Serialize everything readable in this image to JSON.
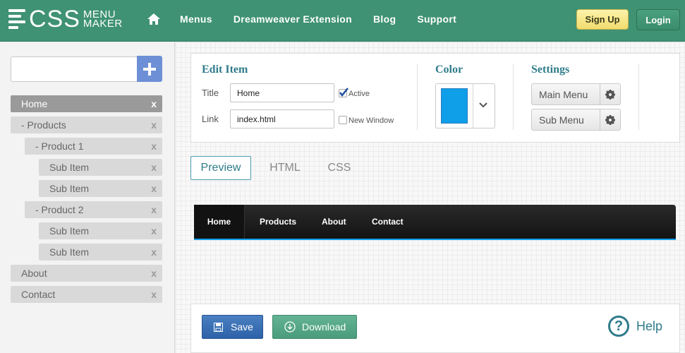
{
  "header": {
    "logo_text": "CSS",
    "logo_line1": "MENU",
    "logo_line2": "MAKER",
    "nav": [
      "Menus",
      "Dreamweaver Extension",
      "Blog",
      "Support"
    ],
    "signup_label": "Sign Up",
    "login_label": "Login"
  },
  "sidebar": {
    "search_value": "",
    "add_label": "+",
    "items": [
      {
        "label": "Home",
        "prefix": "",
        "level": 0,
        "selected": true
      },
      {
        "label": "Products",
        "prefix": "- ",
        "level": 0,
        "selected": false
      },
      {
        "label": "Product 1",
        "prefix": "- ",
        "level": 1,
        "selected": false
      },
      {
        "label": "Sub Item",
        "prefix": "",
        "level": 2,
        "selected": false
      },
      {
        "label": "Sub Item",
        "prefix": "",
        "level": 2,
        "selected": false
      },
      {
        "label": "Product 2",
        "prefix": "- ",
        "level": 1,
        "selected": false
      },
      {
        "label": "Sub Item",
        "prefix": "",
        "level": 2,
        "selected": false
      },
      {
        "label": "Sub Item",
        "prefix": "",
        "level": 2,
        "selected": false
      },
      {
        "label": "About",
        "prefix": "",
        "level": 0,
        "selected": false
      },
      {
        "label": "Contact",
        "prefix": "",
        "level": 0,
        "selected": false
      }
    ],
    "remove_label": "x"
  },
  "edit_item": {
    "heading": "Edit Item",
    "title_label": "Title",
    "title_value": "Home",
    "active_label": "Active",
    "active_checked": true,
    "link_label": "Link",
    "link_value": "index.html",
    "new_window_label": "New Window",
    "new_window_checked": false
  },
  "color": {
    "heading": "Color",
    "value": "#0f9ee8"
  },
  "settings": {
    "heading": "Settings",
    "main_menu_label": "Main Menu",
    "sub_menu_label": "Sub Menu"
  },
  "tabs": [
    "Preview",
    "HTML",
    "CSS"
  ],
  "active_tab": "Preview",
  "preview_menu": {
    "items": [
      "Home",
      "Products",
      "About",
      "Contact"
    ],
    "active": "Home",
    "accent_color": "#0f9ee8"
  },
  "footer": {
    "save_label": "Save",
    "download_label": "Download",
    "help_label": "Help",
    "help_symbol": "?"
  }
}
